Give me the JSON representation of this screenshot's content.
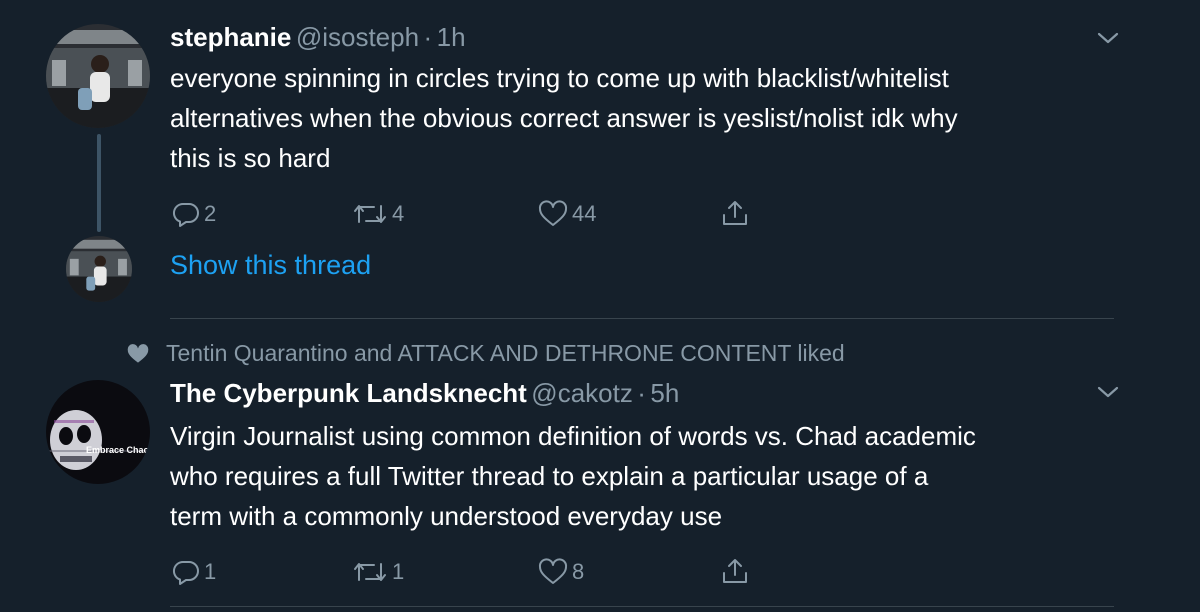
{
  "tweets": [
    {
      "display_name": "stephanie",
      "handle": "@isosteph",
      "separator": "·",
      "time": "1h",
      "text": "everyone spinning in circles trying to come up with blacklist/whitelist\nalternatives when the obvious correct answer is yeslist/nolist idk why\nthis is so hard",
      "replies": "2",
      "retweets": "4",
      "likes": "44"
    },
    {
      "social_context": "Tentin Quarantino and ATTACK AND DETHRONE CONTENT liked",
      "display_name": "The Cyberpunk Landsknecht",
      "handle": "@cakotz",
      "separator": "·",
      "time": "5h",
      "avatar_text": "Embrace Chaos",
      "text": "Virgin Journalist using common definition of words vs. Chad academic\nwho requires a full Twitter thread to explain a particular usage of a\nterm with a commonly understood everyday use",
      "replies": "1",
      "retweets": "1",
      "likes": "8"
    }
  ],
  "show_thread_label": "Show this thread",
  "colors": {
    "background": "#15202b",
    "text_primary": "#ffffff",
    "text_secondary": "#8899a6",
    "link": "#1da1f2",
    "divider": "#38444d"
  },
  "icons": [
    "reply-icon",
    "retweet-icon",
    "like-icon",
    "share-icon",
    "chevron-down-icon",
    "heart-filled-icon"
  ]
}
